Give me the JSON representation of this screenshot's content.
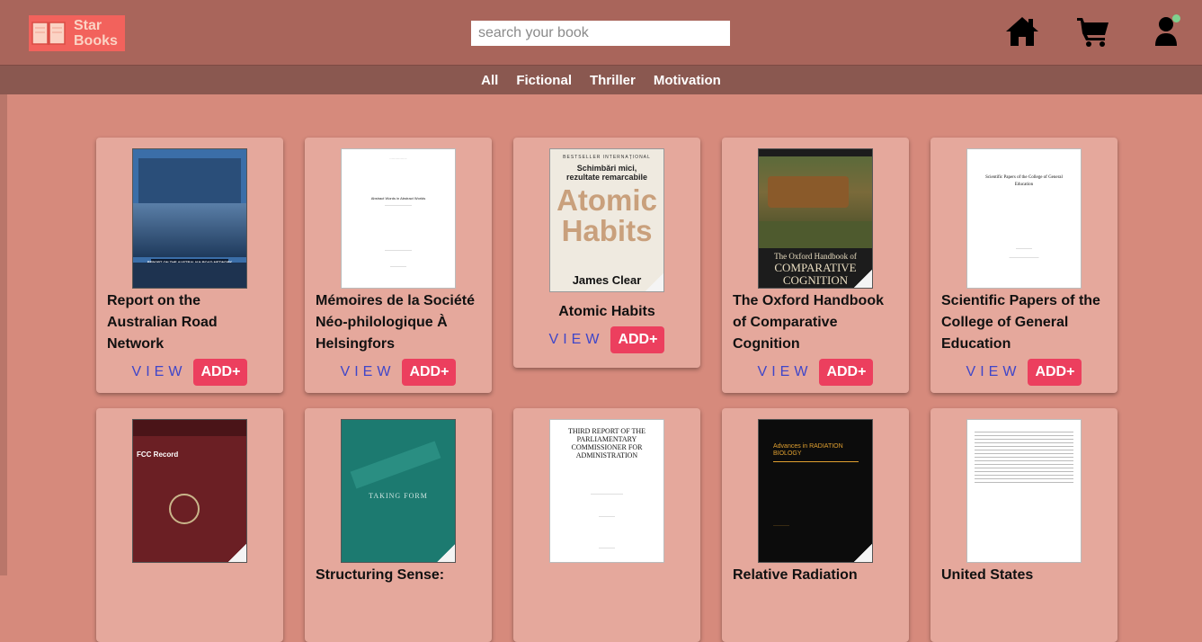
{
  "brand": {
    "line1": "Star",
    "line2": "Books"
  },
  "search": {
    "placeholder": "search your book"
  },
  "categories": [
    "All",
    "Fictional",
    "Thriller",
    "Motivation"
  ],
  "card_actions": {
    "view": "VIEW",
    "add": "ADD+"
  },
  "books_row1": [
    {
      "title": "Report on the Australian Road Network",
      "cover_text": "REPORT ON THE AUSTRALIAN ROAD NETWORK"
    },
    {
      "title": "Mémoires de la Société Néo-philologique À Helsingfors",
      "cover_text": "Abstract Words in Abstract Worlds"
    },
    {
      "title": "Atomic Habits",
      "cover_top": "BESTSELLER INTERNAȚIONAL",
      "cover_sub": "Schimbări mici, rezultate remarcabile",
      "cover_big1": "Atomic",
      "cover_big2": "Habits",
      "cover_author": "James Clear"
    },
    {
      "title": "The Oxford Handbook of Comparative Cognition",
      "cover_line1": "The Oxford Handbook of",
      "cover_line2": "COMPARATIVE",
      "cover_line3": "COGNITION"
    },
    {
      "title": "Scientific Papers of the College of General Education",
      "cover_text": "Scientific Papers of the College of General Education"
    }
  ],
  "books_row2": [
    {
      "title": "",
      "cover_text": "FCC Record"
    },
    {
      "title": "Structuring Sense:",
      "cover_text": "TAKING FORM"
    },
    {
      "title": "",
      "cover_text": "THIRD REPORT OF THE PARLIAMENTARY COMMISSIONER FOR ADMINISTRATION"
    },
    {
      "title": "Relative Radiation",
      "cover_text": "Advances in RADIATION BIOLOGY"
    },
    {
      "title": "United States",
      "cover_text": ""
    }
  ]
}
